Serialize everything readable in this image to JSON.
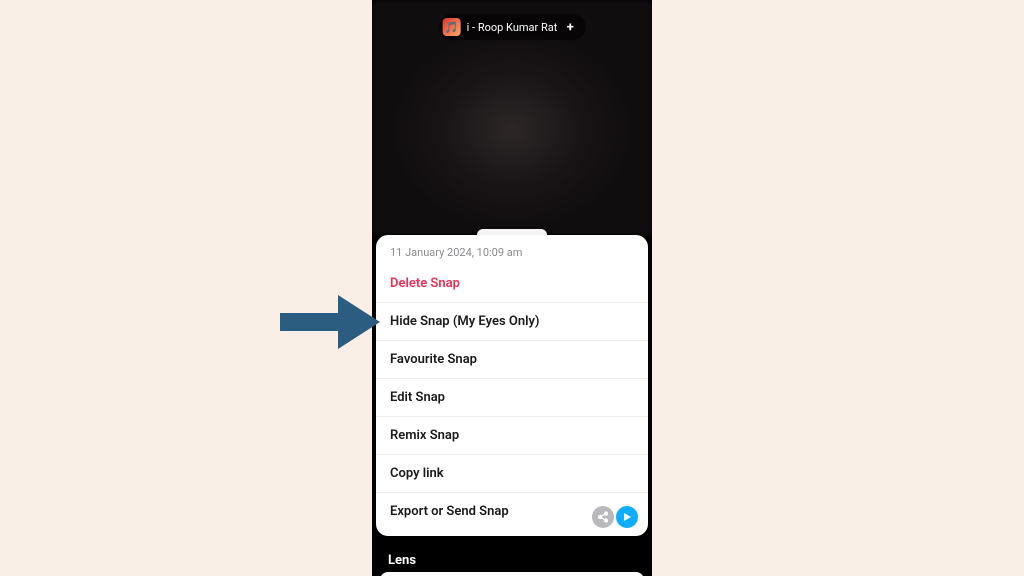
{
  "header": {
    "music_label": "i - Roop Kumar Rat",
    "add_label": "+"
  },
  "sheet": {
    "timestamp": "11 January 2024, 10:09 am",
    "items": [
      {
        "label": "Delete Snap",
        "danger": true
      },
      {
        "label": "Hide Snap (My Eyes Only)"
      },
      {
        "label": "Favourite Snap"
      },
      {
        "label": "Edit Snap"
      },
      {
        "label": "Remix Snap"
      },
      {
        "label": "Copy link"
      },
      {
        "label": "Export or Send Snap"
      }
    ]
  },
  "lens": {
    "label": "Lens"
  },
  "annotation": {
    "type": "arrow",
    "points_to": "Hide Snap (My Eyes Only)",
    "color": "#2b5d80"
  }
}
